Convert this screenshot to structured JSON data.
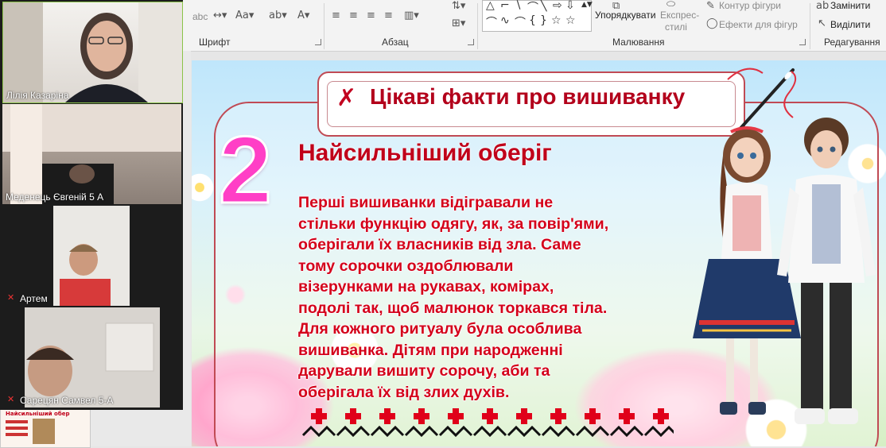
{
  "ribbon": {
    "groups": {
      "font": "Шрифт",
      "paragraph": "Абзац",
      "drawing": "Малювання",
      "editing": "Редагування"
    },
    "arrange_label": "Упорядкувати",
    "quick_styles_label": "Експрес-",
    "quick_styles_label2": "стилі",
    "shape_outline": "Контур фігури",
    "shape_effects": "Ефекти для фігур",
    "replace": "Замінити",
    "select": "Виділити"
  },
  "participants": [
    {
      "name": "Лілія Казаріна",
      "muted": false
    },
    {
      "name": "Меденець Євгеній 5 А",
      "muted": false
    },
    {
      "name": "Артем",
      "muted": true
    },
    {
      "name": "Сарецян Самвел 5-А",
      "muted": true
    }
  ],
  "thumbnail": {
    "title": "Найсильніший обер"
  },
  "slide": {
    "title": "Цікаві факти про вишиванку",
    "number": "2",
    "subtitle": "Найсильніший оберіг",
    "body_lines": [
      "Перші вишиванки відігравали не",
      "стільки функцію одягу, як, за повір'ями,",
      "оберігали їх власників від зла. Саме",
      "тому сорочки оздоблювали",
      "візерунками на рукавах, комірах,",
      "подолі так, щоб малюнок торкався тіла.",
      "Для кожного ритуалу була особлива",
      "вишиванка. Дітям при народженні",
      "дарували вишиту сорочу, аби та",
      "оберігала їх від злих духів."
    ]
  },
  "colors": {
    "accent_red": "#d4001a",
    "number_pink": "#ff3fc6",
    "frame_red": "#c04a54",
    "mute_red": "#e33333"
  }
}
